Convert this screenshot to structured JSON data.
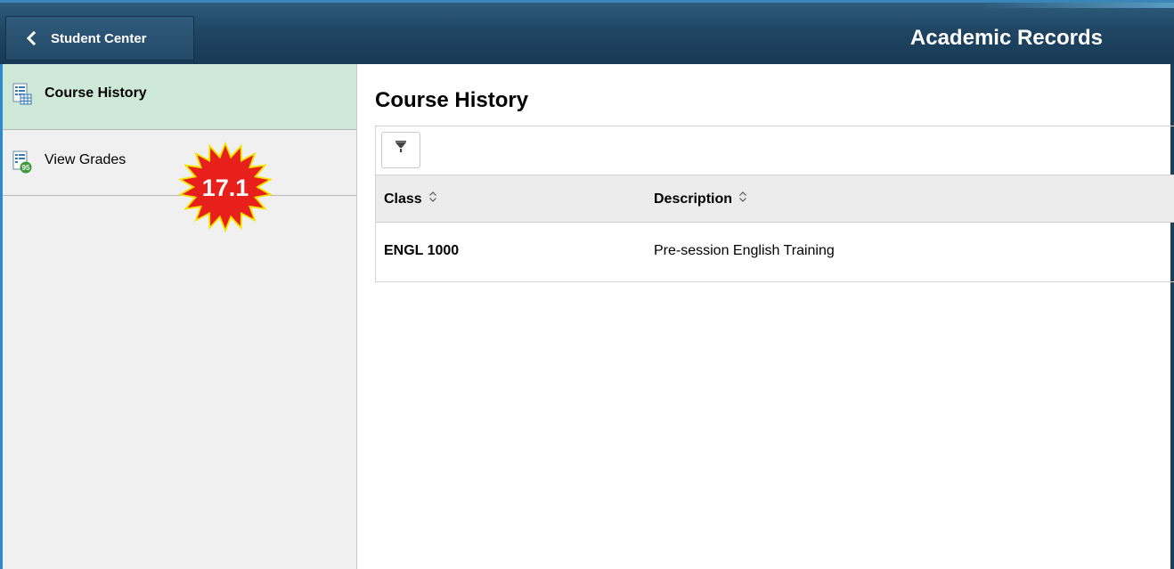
{
  "header": {
    "back_label": "Student Center",
    "title": "Academic Records"
  },
  "sidebar": {
    "items": [
      {
        "label": "Course History",
        "icon": "course-history-icon",
        "active": true
      },
      {
        "label": "View Grades",
        "icon": "view-grades-icon",
        "active": false
      }
    ],
    "badge_text": "17.1"
  },
  "main": {
    "page_title": "Course History",
    "filter_icon": "filter-icon",
    "table": {
      "columns": [
        "Class",
        "Description"
      ],
      "rows": [
        [
          "ENGL 1000",
          "Pre-session English Training"
        ]
      ]
    }
  },
  "colors": {
    "header_bg": "#1f4563",
    "active_item_bg": "#cfe9d8",
    "sidebar_accent": "#2a8bd0",
    "badge_fill": "#e8201c",
    "badge_outline": "#f5e400"
  }
}
